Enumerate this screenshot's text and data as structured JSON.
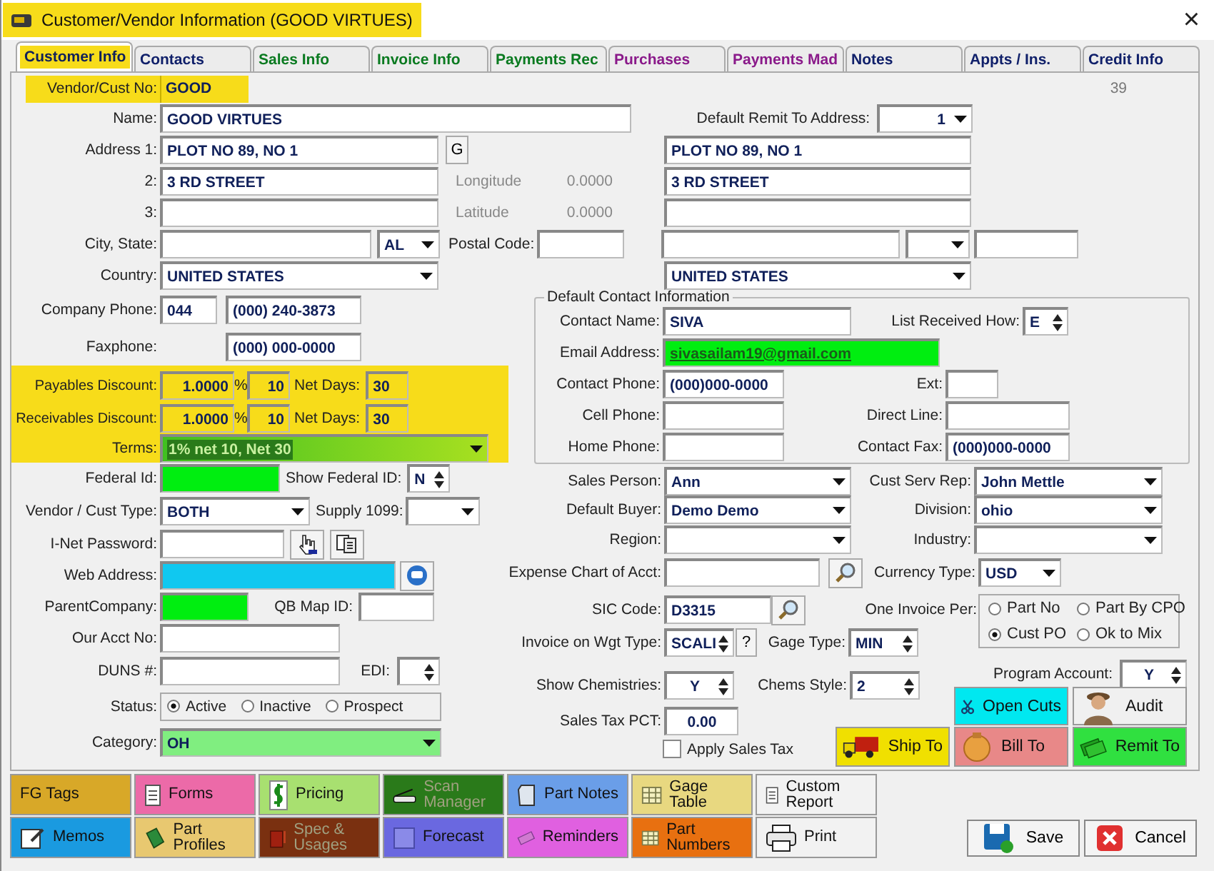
{
  "window": {
    "title": "Customer/Vendor Information  (GOOD VIRTUES)",
    "close": "×"
  },
  "tabs": [
    {
      "label": "Customer Info",
      "selected": true,
      "color": "#10205a"
    },
    {
      "label": "Contacts",
      "selected": false,
      "color": "#10206a"
    },
    {
      "label": "Sales Info",
      "selected": false,
      "color": "#0a7a20"
    },
    {
      "label": "Invoice Info",
      "selected": false,
      "color": "#0a7a20"
    },
    {
      "label": "Payments Rec",
      "selected": false,
      "color": "#0a7a20"
    },
    {
      "label": "Purchases",
      "selected": false,
      "color": "#8a1a8a"
    },
    {
      "label": "Payments Mad",
      "selected": false,
      "color": "#8a1a8a"
    },
    {
      "label": "Notes",
      "selected": false,
      "color": "#10206a"
    },
    {
      "label": "Appts / Ins.",
      "selected": false,
      "color": "#10206a"
    },
    {
      "label": "Credit Info",
      "selected": false,
      "color": "#10206a"
    }
  ],
  "record_number": "39",
  "vendor_no": {
    "label": "Vendor/Cust No:",
    "value": "GOOD"
  },
  "name": {
    "label": "Name:",
    "value": "GOOD VIRTUES"
  },
  "address": [
    {
      "label": "Address 1:",
      "value": "PLOT NO 89, NO 1"
    },
    {
      "label": "2:",
      "value": "3 RD STREET"
    },
    {
      "label": "3:"
    }
  ],
  "geocode_button": "G",
  "longitude": {
    "label": "Longitude",
    "value": "0.0000"
  },
  "latitude": {
    "label": "Latitude",
    "value": "0.0000"
  },
  "city_state": {
    "label": "City, State:",
    "state": "AL"
  },
  "postal_code": {
    "label": "Postal Code:"
  },
  "country": {
    "label": "Country:",
    "value": "UNITED STATES"
  },
  "remit": {
    "label": "Default Remit To Address:",
    "value": "1",
    "lines": [
      "PLOT NO 89, NO 1",
      "3 RD STREET"
    ],
    "country": "UNITED STATES"
  },
  "company_phone": {
    "label": "Company Phone:",
    "area": "044",
    "number": "(000) 240-3873"
  },
  "faxphone": {
    "label": "Faxphone:",
    "value": "(000) 000-0000"
  },
  "discounts": [
    {
      "label": "Payables Discount:",
      "percent": "1.0000",
      "percent_sign": "%",
      "days": "10",
      "net_label": "Net Days:",
      "net_days": "30"
    },
    {
      "label": "Receivables Discount:",
      "percent": "1.0000",
      "percent_sign": "%",
      "days": "10",
      "net_label": "Net Days:",
      "net_days": "30"
    }
  ],
  "terms": {
    "label": "Terms:",
    "value": "1% net 10, Net 30"
  },
  "federal_id": {
    "label": "Federal Id:",
    "show_label": "Show Federal ID:",
    "show_value": "N"
  },
  "vendor_type": {
    "label": "Vendor / Cust Type:",
    "value": "BOTH",
    "supply_label": "Supply 1099:"
  },
  "inet_password": {
    "label": "I-Net Password:"
  },
  "web_address": {
    "label": "Web Address:"
  },
  "parent_company": {
    "label": "ParentCompany:",
    "qb_label": "QB Map ID:"
  },
  "our_acct": {
    "label": "Our Acct No:"
  },
  "duns": {
    "label": "DUNS #:",
    "edi_label": "EDI:"
  },
  "status": {
    "label": "Status:",
    "options": [
      {
        "label": "Active",
        "selected": true
      },
      {
        "label": "Inactive",
        "selected": false
      },
      {
        "label": "Prospect",
        "selected": false
      }
    ]
  },
  "category": {
    "label": "Category:",
    "value": "OH"
  },
  "contact": {
    "title": "Default Contact Information",
    "name": {
      "label": "Contact Name:",
      "value": "SIVA"
    },
    "list_received": {
      "label": "List Received How:",
      "value": "E"
    },
    "email": {
      "label": "Email Address:",
      "value": "sivasailam19@gmail.com"
    },
    "phone": {
      "label": "Contact Phone:",
      "value": "(000)000-0000"
    },
    "ext": {
      "label": "Ext:"
    },
    "cell": {
      "label": "Cell Phone:"
    },
    "direct": {
      "label": "Direct Line:"
    },
    "home": {
      "label": "Home Phone:"
    },
    "fax": {
      "label": "Contact Fax:",
      "value": "(000)000-0000"
    }
  },
  "sales_person": {
    "label": "Sales Person:",
    "value": "Ann"
  },
  "cust_serv_rep": {
    "label": "Cust Serv Rep:",
    "value": "John Mettle"
  },
  "default_buyer": {
    "label": "Default Buyer:",
    "value": "Demo Demo"
  },
  "division": {
    "label": "Division:",
    "value": "ohio"
  },
  "region": {
    "label": "Region:"
  },
  "industry": {
    "label": "Industry:"
  },
  "expense_account": {
    "label": "Expense Chart of Acct:"
  },
  "currency": {
    "label": "Currency Type:",
    "value": "USD"
  },
  "sic_code": {
    "label": "SIC Code:",
    "value": "D3315"
  },
  "one_invoice_per": {
    "label": "One Invoice Per:",
    "options": [
      {
        "label": "Part No",
        "selected": false
      },
      {
        "label": "Part By CPO",
        "selected": false
      },
      {
        "label": "Cust PO",
        "selected": true
      },
      {
        "label": "Ok to Mix",
        "selected": false
      }
    ]
  },
  "invoice_wgt": {
    "label": "Invoice on Wgt Type:",
    "value": "SCALI",
    "help": "?"
  },
  "gage_type": {
    "label": "Gage Type:",
    "value": "MIN"
  },
  "program_account": {
    "label": "Program Account:",
    "value": "Y"
  },
  "show_chemistries": {
    "label": "Show Chemistries:",
    "value": "Y"
  },
  "chems_style": {
    "label": "Chems Style:",
    "value": "2"
  },
  "sales_tax": {
    "label": "Sales Tax PCT:",
    "value": "0.00"
  },
  "apply_sales_tax": {
    "label": "Apply Sales Tax",
    "checked": false
  },
  "action_buttons": [
    {
      "label": "Open Cuts",
      "color": "#00e8f0"
    },
    {
      "label": "Audit",
      "color": "#f0f0f0"
    },
    {
      "label": "Ship To",
      "color": "#f0e000"
    },
    {
      "label": "Bill To",
      "color": "#e88888"
    },
    {
      "label": "Remit To",
      "color": "#30e040"
    }
  ],
  "tool_buttons": [
    {
      "label": "FG Tags",
      "color": "#d8a828",
      "disabled": false
    },
    {
      "label": "Forms",
      "color": "#ec6aa8",
      "disabled": false
    },
    {
      "label": "Pricing",
      "color": "#a8e070",
      "disabled": false
    },
    {
      "label": "Scan Manager",
      "color": "#2a7a1a",
      "disabled": true
    },
    {
      "label": "Part Notes",
      "color": "#6a9ee8",
      "disabled": false
    },
    {
      "label": "Gage Table",
      "color": "#e8d880",
      "disabled": false
    },
    {
      "label": "Custom Report",
      "color": "#f2f2f2",
      "disabled": false
    },
    {
      "label": "Memos",
      "color": "#1a9ae0",
      "disabled": false
    },
    {
      "label": "Part Profiles",
      "color": "#e8c870",
      "disabled": false
    },
    {
      "label": "Spec & Usages",
      "color": "#7a3010",
      "disabled": true
    },
    {
      "label": "Forecast",
      "color": "#6a68e0",
      "disabled": false
    },
    {
      "label": "Reminders",
      "color": "#e060e0",
      "disabled": false
    },
    {
      "label": "Part Numbers",
      "color": "#e87010",
      "disabled": false
    },
    {
      "label": "Print",
      "color": "#f2f2f2",
      "disabled": false
    }
  ],
  "save_button": "Save",
  "cancel_button": "Cancel"
}
